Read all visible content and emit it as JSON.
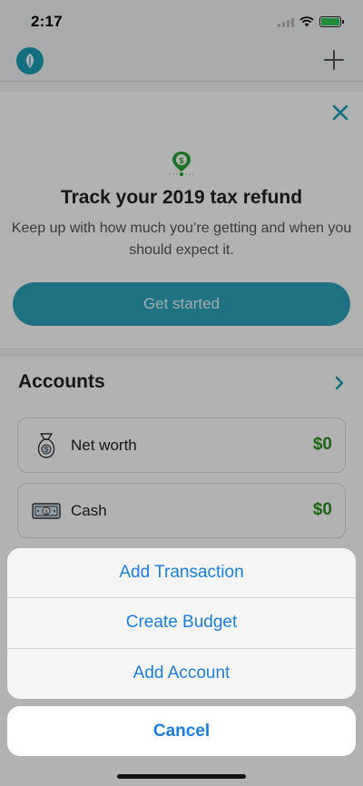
{
  "status_bar": {
    "time": "2:17",
    "icons": [
      "cellular-signal-icon",
      "wifi-icon",
      "battery-charging-icon"
    ]
  },
  "header": {
    "logo_icon": "leaf-logo-icon",
    "add_icon": "plus-icon"
  },
  "promo": {
    "close_icon": "close-icon",
    "pin_icon": "dollar-pin-icon",
    "title": "Track your 2019 tax refund",
    "description": "Keep up with how much you’re getting and when you should expect it.",
    "cta_label": "Get started"
  },
  "accounts": {
    "title": "Accounts",
    "chevron_icon": "chevron-right-icon",
    "items": [
      {
        "label": "Net worth",
        "value": "$0",
        "icon": "money-bag-icon"
      },
      {
        "label": "Cash",
        "value": "$0",
        "icon": "cash-bill-icon"
      }
    ]
  },
  "action_sheet": {
    "items": [
      {
        "label": "Add Transaction"
      },
      {
        "label": "Create Budget"
      },
      {
        "label": "Add Account"
      }
    ],
    "cancel_label": "Cancel"
  },
  "colors": {
    "accent": "#1a7fe0",
    "brand": "#1a9fb7",
    "positive": "#2a8e1d",
    "cta": "#2ba4b9"
  }
}
